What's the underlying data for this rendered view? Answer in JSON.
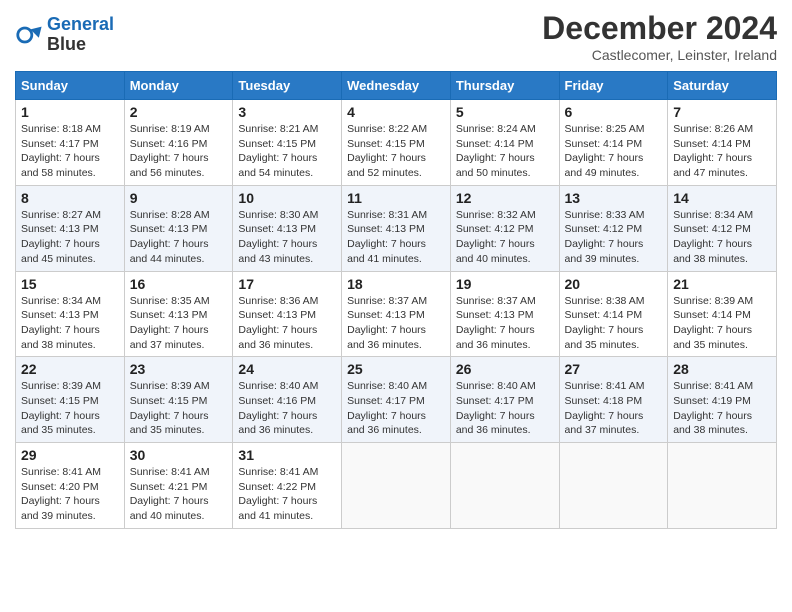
{
  "header": {
    "logo_line1": "General",
    "logo_line2": "Blue",
    "month": "December 2024",
    "location": "Castlecomer, Leinster, Ireland"
  },
  "days_of_week": [
    "Sunday",
    "Monday",
    "Tuesday",
    "Wednesday",
    "Thursday",
    "Friday",
    "Saturday"
  ],
  "weeks": [
    [
      {
        "day": "1",
        "sunrise": "8:18 AM",
        "sunset": "4:17 PM",
        "daylight": "7 hours and 58 minutes."
      },
      {
        "day": "2",
        "sunrise": "8:19 AM",
        "sunset": "4:16 PM",
        "daylight": "7 hours and 56 minutes."
      },
      {
        "day": "3",
        "sunrise": "8:21 AM",
        "sunset": "4:15 PM",
        "daylight": "7 hours and 54 minutes."
      },
      {
        "day": "4",
        "sunrise": "8:22 AM",
        "sunset": "4:15 PM",
        "daylight": "7 hours and 52 minutes."
      },
      {
        "day": "5",
        "sunrise": "8:24 AM",
        "sunset": "4:14 PM",
        "daylight": "7 hours and 50 minutes."
      },
      {
        "day": "6",
        "sunrise": "8:25 AM",
        "sunset": "4:14 PM",
        "daylight": "7 hours and 49 minutes."
      },
      {
        "day": "7",
        "sunrise": "8:26 AM",
        "sunset": "4:14 PM",
        "daylight": "7 hours and 47 minutes."
      }
    ],
    [
      {
        "day": "8",
        "sunrise": "8:27 AM",
        "sunset": "4:13 PM",
        "daylight": "7 hours and 45 minutes."
      },
      {
        "day": "9",
        "sunrise": "8:28 AM",
        "sunset": "4:13 PM",
        "daylight": "7 hours and 44 minutes."
      },
      {
        "day": "10",
        "sunrise": "8:30 AM",
        "sunset": "4:13 PM",
        "daylight": "7 hours and 43 minutes."
      },
      {
        "day": "11",
        "sunrise": "8:31 AM",
        "sunset": "4:13 PM",
        "daylight": "7 hours and 41 minutes."
      },
      {
        "day": "12",
        "sunrise": "8:32 AM",
        "sunset": "4:12 PM",
        "daylight": "7 hours and 40 minutes."
      },
      {
        "day": "13",
        "sunrise": "8:33 AM",
        "sunset": "4:12 PM",
        "daylight": "7 hours and 39 minutes."
      },
      {
        "day": "14",
        "sunrise": "8:34 AM",
        "sunset": "4:12 PM",
        "daylight": "7 hours and 38 minutes."
      }
    ],
    [
      {
        "day": "15",
        "sunrise": "8:34 AM",
        "sunset": "4:13 PM",
        "daylight": "7 hours and 38 minutes."
      },
      {
        "day": "16",
        "sunrise": "8:35 AM",
        "sunset": "4:13 PM",
        "daylight": "7 hours and 37 minutes."
      },
      {
        "day": "17",
        "sunrise": "8:36 AM",
        "sunset": "4:13 PM",
        "daylight": "7 hours and 36 minutes."
      },
      {
        "day": "18",
        "sunrise": "8:37 AM",
        "sunset": "4:13 PM",
        "daylight": "7 hours and 36 minutes."
      },
      {
        "day": "19",
        "sunrise": "8:37 AM",
        "sunset": "4:13 PM",
        "daylight": "7 hours and 36 minutes."
      },
      {
        "day": "20",
        "sunrise": "8:38 AM",
        "sunset": "4:14 PM",
        "daylight": "7 hours and 35 minutes."
      },
      {
        "day": "21",
        "sunrise": "8:39 AM",
        "sunset": "4:14 PM",
        "daylight": "7 hours and 35 minutes."
      }
    ],
    [
      {
        "day": "22",
        "sunrise": "8:39 AM",
        "sunset": "4:15 PM",
        "daylight": "7 hours and 35 minutes."
      },
      {
        "day": "23",
        "sunrise": "8:39 AM",
        "sunset": "4:15 PM",
        "daylight": "7 hours and 35 minutes."
      },
      {
        "day": "24",
        "sunrise": "8:40 AM",
        "sunset": "4:16 PM",
        "daylight": "7 hours and 36 minutes."
      },
      {
        "day": "25",
        "sunrise": "8:40 AM",
        "sunset": "4:17 PM",
        "daylight": "7 hours and 36 minutes."
      },
      {
        "day": "26",
        "sunrise": "8:40 AM",
        "sunset": "4:17 PM",
        "daylight": "7 hours and 36 minutes."
      },
      {
        "day": "27",
        "sunrise": "8:41 AM",
        "sunset": "4:18 PM",
        "daylight": "7 hours and 37 minutes."
      },
      {
        "day": "28",
        "sunrise": "8:41 AM",
        "sunset": "4:19 PM",
        "daylight": "7 hours and 38 minutes."
      }
    ],
    [
      {
        "day": "29",
        "sunrise": "8:41 AM",
        "sunset": "4:20 PM",
        "daylight": "7 hours and 39 minutes."
      },
      {
        "day": "30",
        "sunrise": "8:41 AM",
        "sunset": "4:21 PM",
        "daylight": "7 hours and 40 minutes."
      },
      {
        "day": "31",
        "sunrise": "8:41 AM",
        "sunset": "4:22 PM",
        "daylight": "7 hours and 41 minutes."
      },
      null,
      null,
      null,
      null
    ]
  ]
}
